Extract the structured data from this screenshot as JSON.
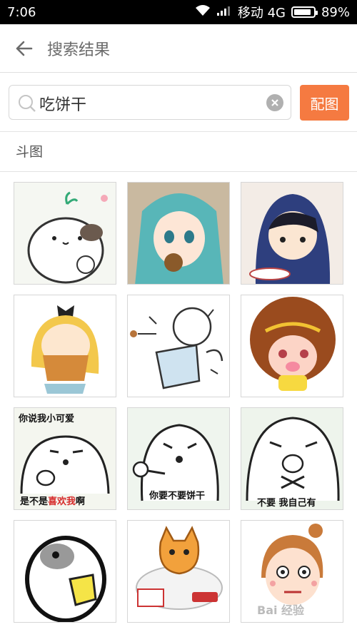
{
  "status_bar": {
    "time": "7:06",
    "carrier": "移动 4G",
    "battery": "89%",
    "battery_level": 0.89
  },
  "header": {
    "title": "搜索结果"
  },
  "search": {
    "query": "吃饼干",
    "button_label": "配图"
  },
  "section": {
    "title": "斗图"
  },
  "stickers": [
    {
      "caption": ""
    },
    {
      "caption": ""
    },
    {
      "caption": ""
    },
    {
      "caption": ""
    },
    {
      "caption": ""
    },
    {
      "caption": ""
    },
    {
      "caption_top": "你说我小可爱",
      "caption_bottom_a": "是不是",
      "caption_bottom_b": "喜欢我",
      "caption_bottom_c": "啊"
    },
    {
      "caption_bottom": "你要不要饼干"
    },
    {
      "caption_bottom": "不要 我自己有"
    },
    {
      "caption": ""
    },
    {
      "caption": ""
    },
    {
      "caption": ""
    }
  ],
  "watermark": "Bai 经验",
  "colors": {
    "accent": "#f57a41",
    "title": "#6b6b6b"
  }
}
